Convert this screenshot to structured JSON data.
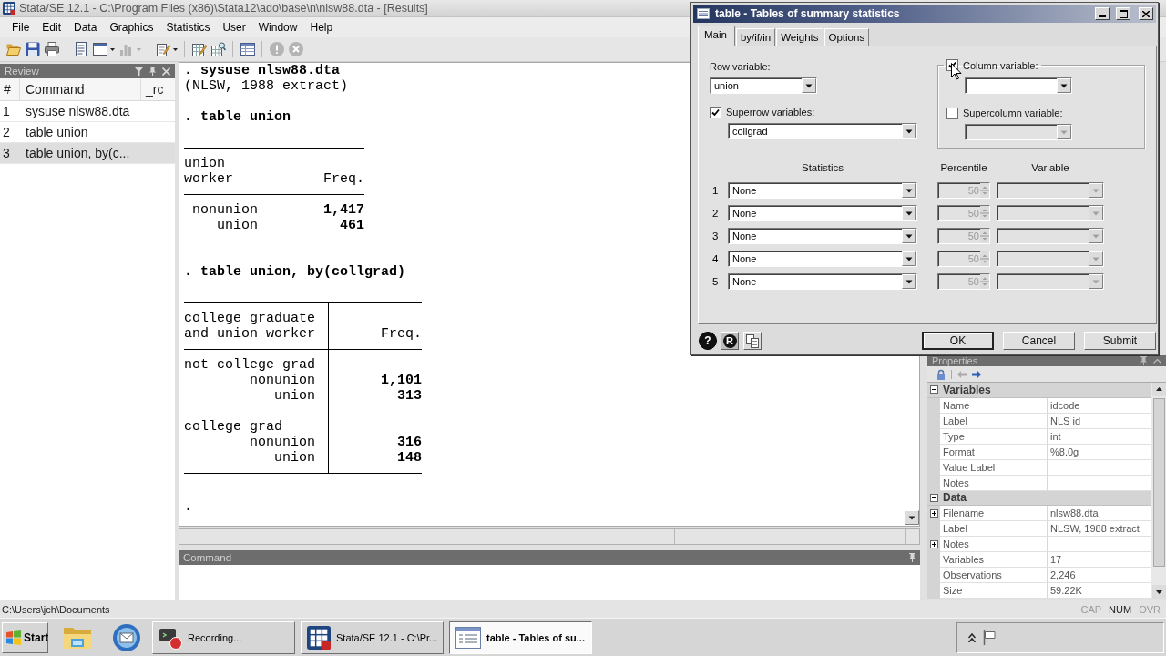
{
  "window": {
    "title": "Stata/SE 12.1 - C:\\Program Files (x86)\\Stata12\\ado\\base\\n\\nlsw88.dta - [Results]"
  },
  "menu": [
    "File",
    "Edit",
    "Data",
    "Graphics",
    "Statistics",
    "User",
    "Window",
    "Help"
  ],
  "toolbar": [
    [
      {
        "kind": "open",
        "disabled": false
      },
      {
        "kind": "save",
        "disabled": false
      },
      {
        "kind": "print",
        "disabled": false
      }
    ],
    [
      {
        "kind": "log",
        "disabled": false
      },
      {
        "kind": "viewer",
        "disabled": false,
        "menu": true
      },
      {
        "kind": "graph",
        "disabled": true,
        "menu": true
      }
    ],
    [
      {
        "kind": "do_editor",
        "disabled": false,
        "menu": true
      }
    ],
    [
      {
        "kind": "data_editor",
        "disabled": false
      },
      {
        "kind": "data_browser",
        "disabled": false
      }
    ],
    [
      {
        "kind": "variables_manager",
        "disabled": false
      }
    ],
    [
      {
        "kind": "break",
        "disabled": true
      },
      {
        "kind": "clear",
        "disabled": true
      }
    ]
  ],
  "review": {
    "title": "Review",
    "columns": [
      "#",
      "Command",
      "_rc"
    ],
    "rows": [
      {
        "number": "1",
        "command": "sysuse nlsw88.dta",
        "selected": false
      },
      {
        "number": "2",
        "command": "table union",
        "selected": false
      },
      {
        "number": "3",
        "command": "table union, by(c...",
        "selected": true
      }
    ]
  },
  "results": {
    "blocks": [
      {
        "kind": "command",
        "text": ". sysuse nlsw88.dta"
      },
      {
        "kind": "note",
        "text": "(NLSW, 1988 extract)"
      },
      {
        "kind": "command",
        "text": ". table union"
      },
      {
        "kind": "table",
        "header": "union\nworker",
        "freq_header": "Freq.",
        "rows": [
          {
            "label": "nonunion",
            "freq": "1,417"
          },
          {
            "label": "union",
            "freq": "461"
          }
        ]
      },
      {
        "kind": "command",
        "text": ". table union, by(collgrad)"
      },
      {
        "kind": "table",
        "header": "college graduate\nand union worker",
        "freq_header": "Freq.",
        "groups": [
          {
            "label": "not college grad",
            "rows": [
              {
                "label": "nonunion",
                "freq": "1,101"
              },
              {
                "label": "union",
                "freq": "313"
              }
            ]
          },
          {
            "label": "college grad",
            "rows": [
              {
                "label": "nonunion",
                "freq": "316"
              },
              {
                "label": "union",
                "freq": "148"
              }
            ]
          }
        ]
      },
      {
        "kind": "prompt",
        "text": "."
      }
    ]
  },
  "command_window": {
    "title": "Command"
  },
  "properties": {
    "title": "Properties",
    "sections": [
      {
        "title": "Variables",
        "expanded": true,
        "rows": [
          {
            "name": "Name",
            "value": "idcode"
          },
          {
            "name": "Label",
            "value": "NLS id"
          },
          {
            "name": "Type",
            "value": "int"
          },
          {
            "name": "Format",
            "value": "%8.0g"
          },
          {
            "name": "Value Label"
          },
          {
            "name": "Notes"
          }
        ]
      },
      {
        "title": "Data",
        "expanded": true,
        "rows": [
          {
            "name": "Filename",
            "value": "nlsw88.dta",
            "expanded": false
          },
          {
            "name": "Label",
            "value": "NLSW, 1988 extract"
          },
          {
            "name": "Notes",
            "expanded": false
          },
          {
            "name": "Variables",
            "value": "17"
          },
          {
            "name": "Observations",
            "value": "2,246"
          },
          {
            "name": "Size",
            "value": "59.22K"
          }
        ]
      }
    ]
  },
  "status_bar": {
    "path": "C:\\Users\\jch\\Documents",
    "indicators": [
      {
        "label": "CAP",
        "on": false
      },
      {
        "label": "NUM",
        "on": true
      },
      {
        "label": "OVR",
        "on": false
      }
    ]
  },
  "taskbar": {
    "start": "Start",
    "quick_launch": [
      {
        "kind": "folder"
      },
      {
        "kind": "mail"
      }
    ],
    "tasks": [
      {
        "kind": "recorder",
        "label": "Recording...",
        "selected": false
      },
      {
        "kind": "stata",
        "label": "Stata/SE 12.1 - C:\\Pr...",
        "selected": false
      },
      {
        "kind": "dialog",
        "label": "table - Tables of su...",
        "selected": true
      }
    ]
  },
  "dialog": {
    "title": "table - Tables of summary statistics",
    "tabs": [
      {
        "label": "Main",
        "selected": true
      },
      {
        "label": "by/if/in",
        "selected": false
      },
      {
        "label": "Weights",
        "selected": false
      },
      {
        "label": "Options",
        "selected": false
      }
    ],
    "row_variable": {
      "label": "Row variable:",
      "value": "union"
    },
    "superrow": {
      "label": "Superrow variables:",
      "checked": true,
      "value": "collgrad"
    },
    "column_variable": {
      "label": "Column variable:",
      "checked": true
    },
    "supercolumn": {
      "label": "Supercolumn variable:",
      "checked": false
    },
    "stat_headers": [
      "Statistics",
      "Percentile",
      "Variable"
    ],
    "stats": [
      {
        "number": "1",
        "statistic": "None",
        "percentile": "50",
        "options_disabled": true
      },
      {
        "number": "2",
        "statistic": "None",
        "percentile": "50",
        "options_disabled": true
      },
      {
        "number": "3",
        "statistic": "None",
        "percentile": "50",
        "options_disabled": true
      },
      {
        "number": "4",
        "statistic": "None",
        "percentile": "50",
        "options_disabled": true
      },
      {
        "number": "5",
        "statistic": "None",
        "percentile": "50",
        "options_disabled": true
      }
    ],
    "help_button": "?",
    "reset_button": "R",
    "buttons": [
      {
        "label": "OK",
        "default": true
      },
      {
        "label": "Cancel",
        "default": false
      },
      {
        "label": "Submit",
        "default": false
      }
    ]
  }
}
